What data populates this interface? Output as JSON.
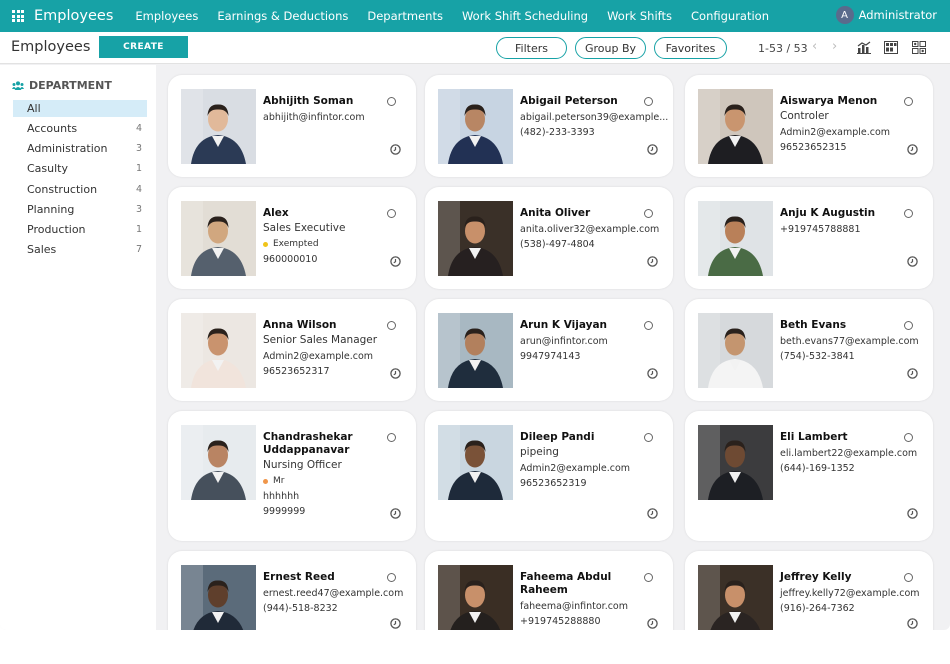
{
  "navbar": {
    "brand": "Employees",
    "items": [
      "Employees",
      "Earnings & Deductions",
      "Departments",
      "Work Shift Scheduling",
      "Work Shifts",
      "Configuration"
    ],
    "user_initial": "A",
    "user_name": "Administrator",
    "bg_color": "#17a2a6"
  },
  "control": {
    "title": "Employees",
    "create_label": "CREATE",
    "filters_label": "Filters",
    "groupby_label": "Group By",
    "favorites_label": "Favorites",
    "pager": "1-53 / 53",
    "prev_icon": "chevron-left-icon",
    "next_icon": "chevron-right-icon",
    "view_icons": [
      "graph-view-icon",
      "activity-view-icon",
      "kanban-view-icon"
    ]
  },
  "sidebar": {
    "title": "DEPARTMENT",
    "icon": "users-icon",
    "categories": [
      {
        "label": "All",
        "count": ""
      },
      {
        "label": "Accounts",
        "count": "4"
      },
      {
        "label": "Administration",
        "count": "3"
      },
      {
        "label": "Casulty",
        "count": "1"
      },
      {
        "label": "Construction",
        "count": "4"
      },
      {
        "label": "Planning",
        "count": "3"
      },
      {
        "label": "Production",
        "count": "1"
      },
      {
        "label": "Sales",
        "count": "7"
      }
    ]
  },
  "employees": [
    {
      "name": "Abhijith Soman",
      "job": "",
      "tag": "",
      "tag_color": "",
      "lines": [
        "abhijith@infintor.com"
      ]
    },
    {
      "name": "Abigail Peterson",
      "job": "",
      "tag": "",
      "tag_color": "",
      "lines": [
        "abigail.peterson39@example...",
        "(482)-233-3393"
      ]
    },
    {
      "name": "Aiswarya Menon",
      "job": "Controler",
      "tag": "",
      "tag_color": "",
      "lines": [
        "Admin2@example.com",
        "96523652315"
      ]
    },
    {
      "name": "Alex",
      "job": "Sales Executive",
      "tag": "Exempted",
      "tag_color": "#f0c419",
      "lines": [
        "960000010"
      ]
    },
    {
      "name": "Anita Oliver",
      "job": "",
      "tag": "",
      "tag_color": "",
      "lines": [
        "anita.oliver32@example.com",
        "(538)-497-4804"
      ]
    },
    {
      "name": "Anju K Augustin",
      "job": "",
      "tag": "",
      "tag_color": "",
      "lines": [
        "+919745788881"
      ]
    },
    {
      "name": "Anna Wilson",
      "job": "Senior Sales Manager",
      "tag": "",
      "tag_color": "",
      "lines": [
        "Admin2@example.com",
        "96523652317"
      ]
    },
    {
      "name": "Arun K Vijayan",
      "job": "",
      "tag": "",
      "tag_color": "",
      "lines": [
        "arun@infintor.com",
        "9947974143"
      ]
    },
    {
      "name": "Beth Evans",
      "job": "",
      "tag": "",
      "tag_color": "",
      "lines": [
        "beth.evans77@example.com",
        "(754)-532-3841"
      ]
    },
    {
      "name": "Chandrashekar Uddappanavar",
      "job": "Nursing Officer",
      "tag": "Mr",
      "tag_color": "#f0964a",
      "lines": [
        "hhhhhh",
        "9999999"
      ]
    },
    {
      "name": "Dileep Pandi",
      "job": "pipeing",
      "tag": "",
      "tag_color": "",
      "lines": [
        "Admin2@example.com",
        "96523652319"
      ]
    },
    {
      "name": "Eli Lambert",
      "job": "",
      "tag": "",
      "tag_color": "",
      "lines": [
        "eli.lambert22@example.com",
        "(644)-169-1352"
      ]
    },
    {
      "name": "Ernest Reed",
      "job": "",
      "tag": "",
      "tag_color": "",
      "lines": [
        "ernest.reed47@example.com",
        "(944)-518-8232"
      ]
    },
    {
      "name": "Faheema Abdul Raheem",
      "job": "",
      "tag": "",
      "tag_color": "",
      "lines": [
        "faheema@infintor.com",
        "+919745288880"
      ]
    },
    {
      "name": "Jeffrey Kelly",
      "job": "",
      "tag": "",
      "tag_color": "",
      "lines": [
        "jeffrey.kelly72@example.com",
        "(916)-264-7362"
      ]
    }
  ]
}
